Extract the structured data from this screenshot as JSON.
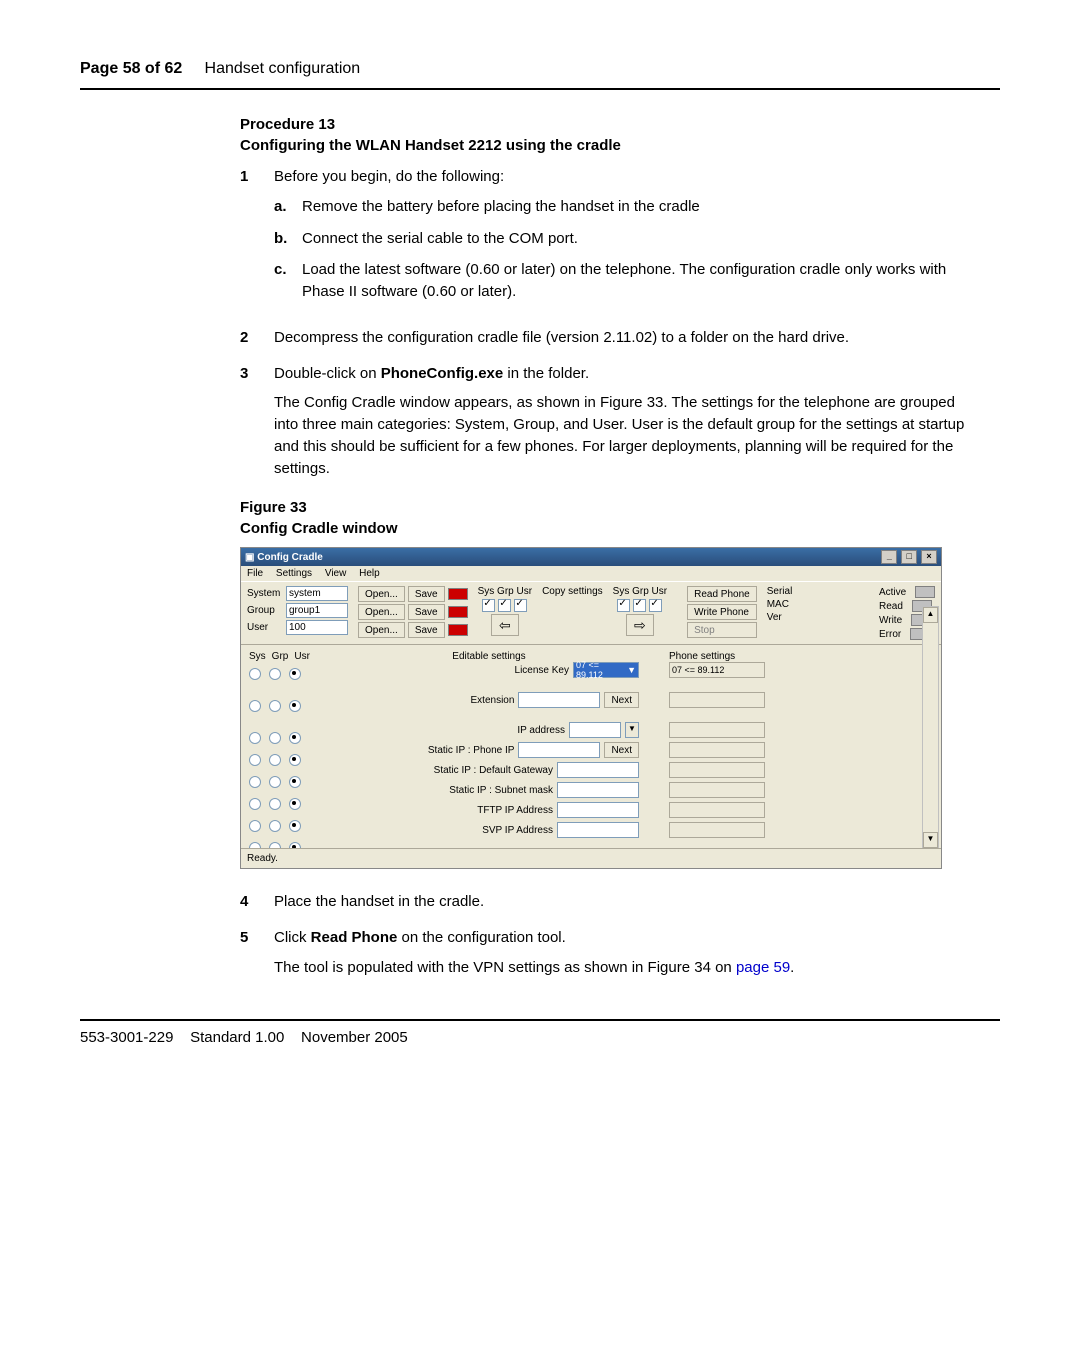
{
  "header": {
    "page": "Page 58 of 62",
    "section": "Handset configuration"
  },
  "procedure": {
    "num": "Procedure 13",
    "title": "Configuring the WLAN Handset 2212 using the cradle"
  },
  "steps": {
    "s1": {
      "n": "1",
      "intro": "Before you begin, do the following:",
      "a": {
        "l": "a.",
        "t": "Remove the battery before placing the handset in the cradle"
      },
      "b": {
        "l": "b.",
        "t": "Connect the serial cable to the COM port."
      },
      "c": {
        "l": "c.",
        "t": "Load the latest software (0.60 or later) on the telephone. The configuration cradle only works with Phase II software (0.60 or later)."
      }
    },
    "s2": {
      "n": "2",
      "t": "Decompress the configuration cradle file (version 2.11.02) to a folder on the hard drive."
    },
    "s3": {
      "n": "3",
      "t1": "Double-click on ",
      "bold": "PhoneConfig.exe",
      "t2": " in the folder.",
      "p": "The Config Cradle window appears, as shown in Figure 33. The settings for the telephone are grouped into three main categories: System, Group, and User. User is the default group for the settings at startup and this should be sufficient for a few phones. For larger deployments, planning will be required for the settings."
    },
    "s4": {
      "n": "4",
      "t": "Place the handset in the cradle."
    },
    "s5": {
      "n": "5",
      "t1": "Click ",
      "bold": "Read Phone",
      "t2": " on the configuration tool.",
      "p1": "The tool is populated with the VPN settings as shown in Figure 34 on ",
      "link": "page 59",
      "p2": "."
    }
  },
  "figure": {
    "num": "Figure 33",
    "title": "Config Cradle window"
  },
  "win": {
    "title": "Config Cradle",
    "menu": {
      "file": "File",
      "settings": "Settings",
      "view": "View",
      "help": "Help"
    },
    "labels": {
      "system": "System",
      "group": "Group",
      "user": "User"
    },
    "vals": {
      "system": "system",
      "group": "group1",
      "user": "100"
    },
    "btn": {
      "open": "Open...",
      "save": "Save",
      "read": "Read Phone",
      "write": "Write Phone",
      "stop": "Stop",
      "next": "Next"
    },
    "copy": {
      "h": "Sys Grp Usr",
      "l": "Copy settings"
    },
    "info": {
      "serial": "Serial",
      "mac": "MAC",
      "ver": "Ver"
    },
    "status": {
      "active": "Active",
      "read": "Read",
      "write": "Write",
      "error": "Error"
    },
    "radh": {
      "sys": "Sys",
      "grp": "Grp",
      "usr": "Usr"
    },
    "mid": {
      "edit": "Editable settings",
      "lic": "License Key",
      "licv": "07 <= 89.112",
      "ext": "Extension",
      "ip": "IP address",
      "sip": "Static IP : Phone IP",
      "gw": "Static IP : Default Gateway",
      "mask": "Static IP : Subnet mask",
      "tftp": "TFTP IP Address",
      "svp": "SVP IP Address"
    },
    "phone": {
      "h": "Phone settings",
      "v": "07 <= 89.112"
    },
    "ready": "Ready."
  },
  "footer": {
    "doc": "553-3001-229",
    "std": "Standard 1.00",
    "date": "November 2005"
  }
}
